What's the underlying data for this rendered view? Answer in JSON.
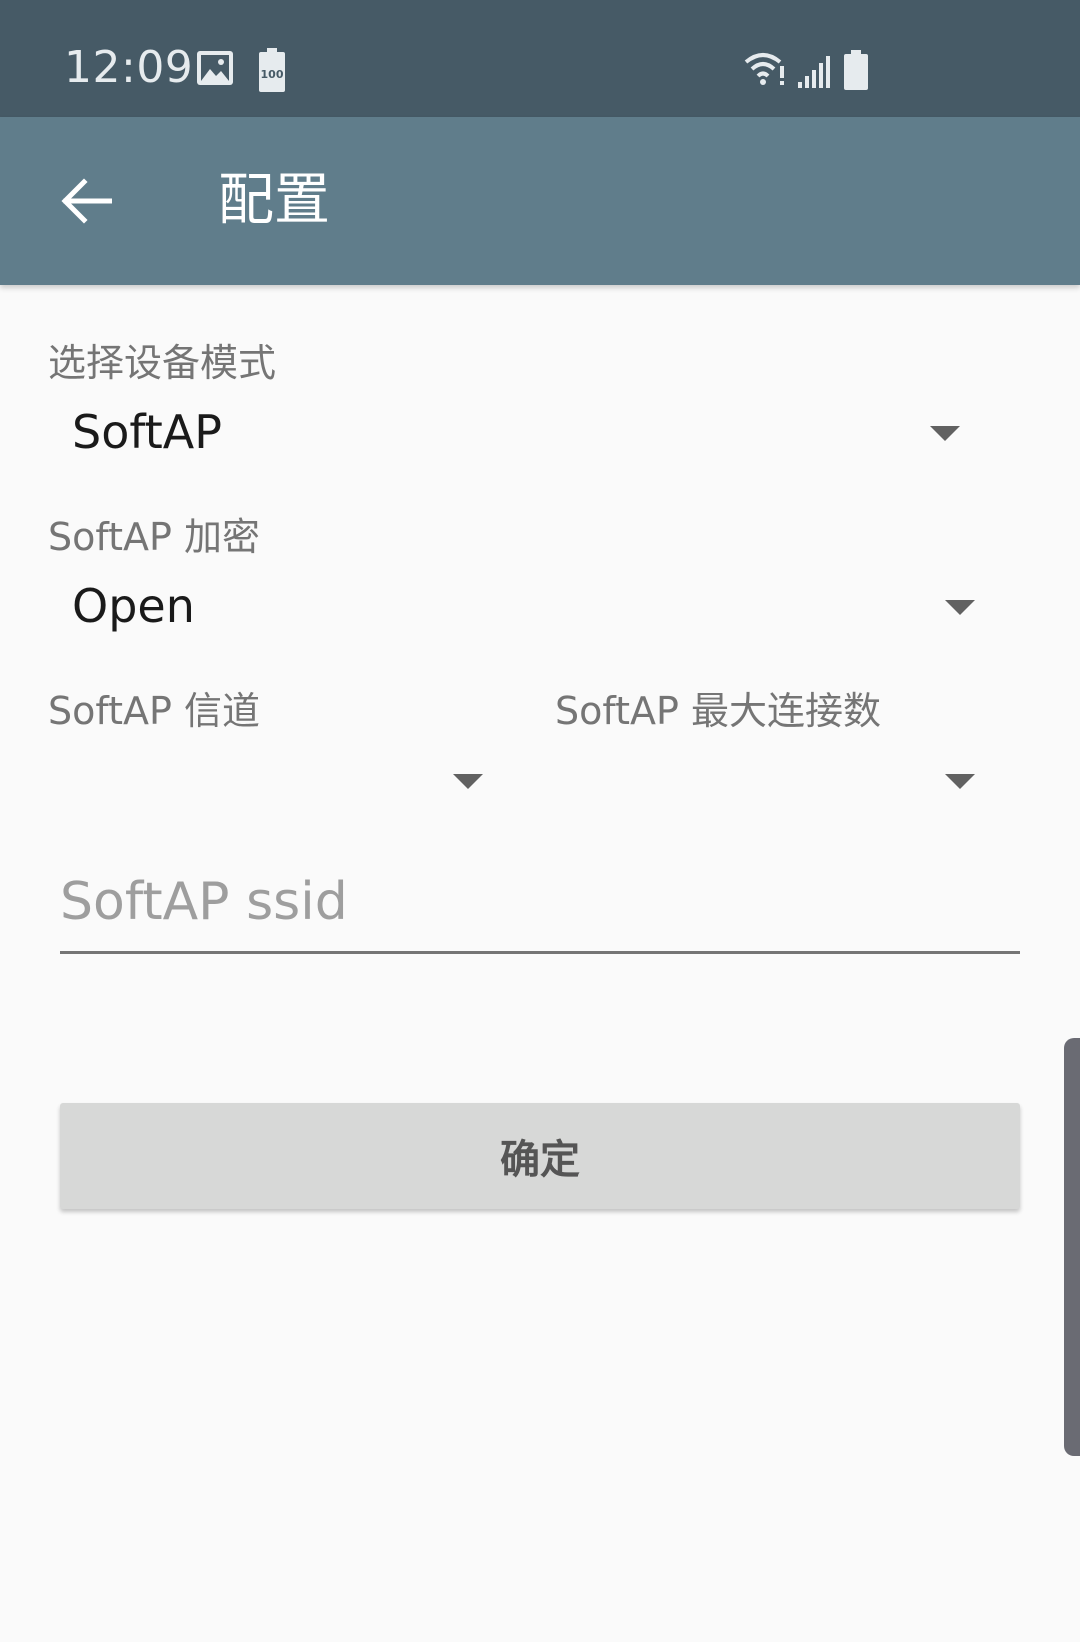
{
  "status_bar": {
    "time": "12:09",
    "battery_saver_level": "100",
    "icons": [
      "image-icon",
      "battery-saver-icon",
      "wifi-icon",
      "signal-icon",
      "battery-icon"
    ]
  },
  "app_bar": {
    "title": "配置",
    "back_icon": "arrow-back-icon"
  },
  "form": {
    "device_mode": {
      "label": "选择设备模式",
      "value": "SoftAP"
    },
    "softap_encryption": {
      "label": "SoftAP 加密",
      "value": "Open"
    },
    "softap_channel": {
      "label": "SoftAP 信道",
      "value": ""
    },
    "softap_max_connections": {
      "label": "SoftAP 最大连接数",
      "value": ""
    },
    "softap_ssid": {
      "placeholder": "SoftAP ssid",
      "value": ""
    },
    "confirm_label": "确定"
  },
  "colors": {
    "status_bar": "#465a66",
    "app_bar": "#607d8b",
    "background": "#fafafa",
    "button": "#d7d8d7"
  }
}
